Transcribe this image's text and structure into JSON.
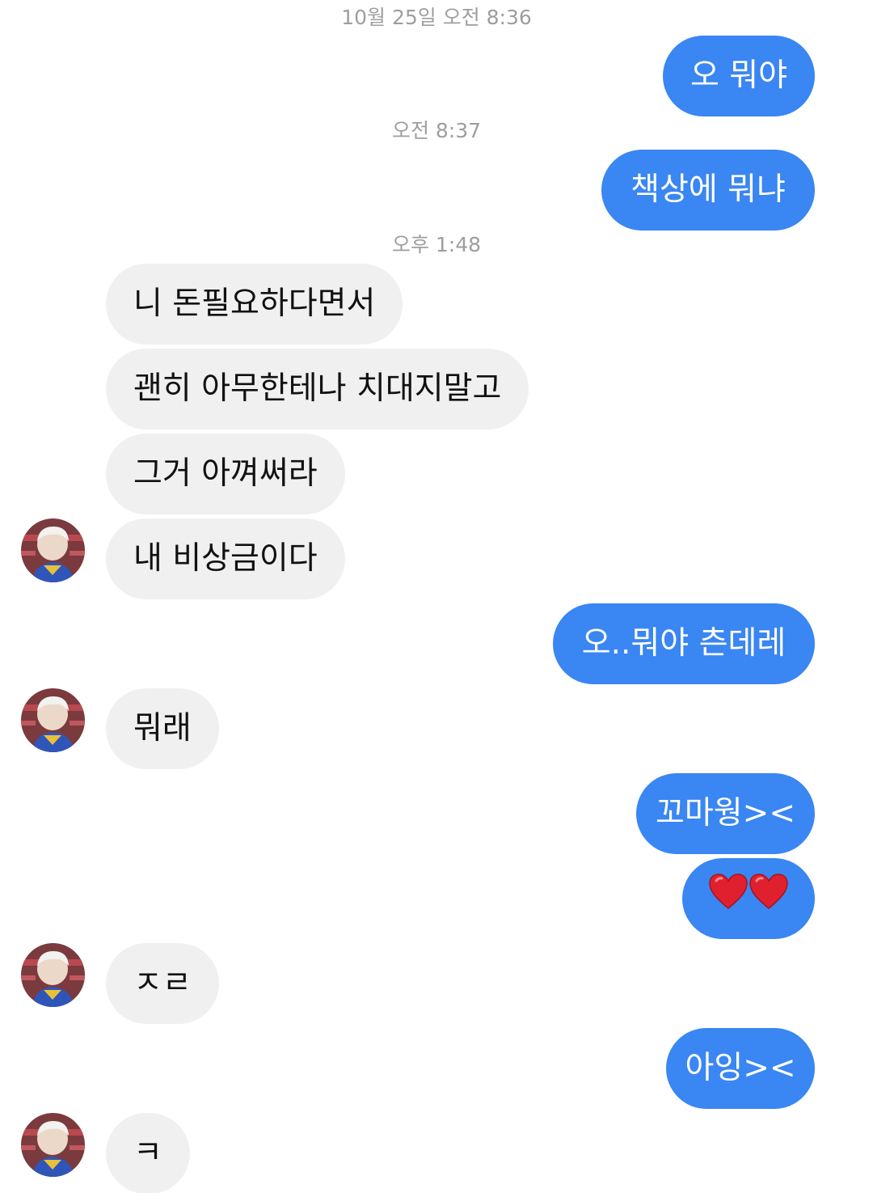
{
  "timestamps": {
    "t1": "10월 25일 오전 8:36",
    "t2": "오전 8:37",
    "t3": "오후 1:48"
  },
  "messages": [
    {
      "from": "me",
      "text": "오 뭐야"
    },
    {
      "from": "me",
      "text": "책상에 뭐냐"
    },
    {
      "from": "them",
      "text": "니 돈필요하다면서"
    },
    {
      "from": "them",
      "text": "괜히 아무한테나 치대지말고"
    },
    {
      "from": "them",
      "text": "그거 아껴써라"
    },
    {
      "from": "them",
      "text": "내 비상금이다"
    },
    {
      "from": "me",
      "text": "오..뭐야 츤데레"
    },
    {
      "from": "them",
      "text": "뭐래"
    },
    {
      "from": "me",
      "text": "꼬마웡><"
    },
    {
      "from": "me",
      "text": "❤❤",
      "icons": [
        "heart-emoji",
        "heart-emoji"
      ]
    },
    {
      "from": "them",
      "text": "ㅈㄹ"
    },
    {
      "from": "me",
      "text": "아잉><"
    },
    {
      "from": "them",
      "text": "ㅋ"
    }
  ],
  "colors": {
    "outgoing_bubble": "#3a86f2",
    "incoming_bubble": "#f0f0f0",
    "timestamp_text": "#9e9e9e",
    "heart": "#e0202e"
  },
  "avatar": {
    "icon": "user-avatar-photo"
  }
}
